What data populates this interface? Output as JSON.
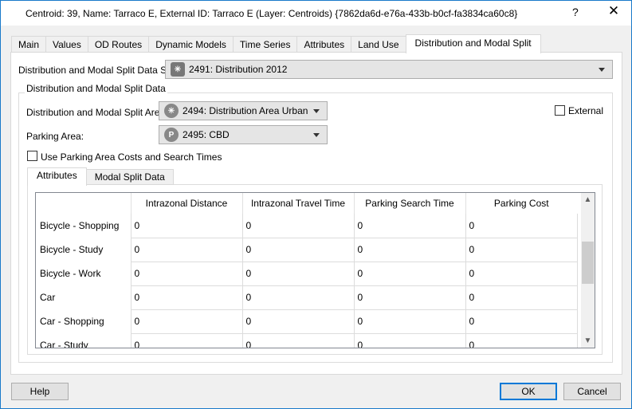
{
  "window": {
    "title": "Centroid: 39, Name: Tarraco E, External ID: Tarraco E (Layer: Centroids) {7862da6d-e76a-433b-b0cf-fa3834ca60c8}",
    "help_glyph": "?",
    "close_glyph": "✕"
  },
  "tabs": [
    {
      "label": "Main",
      "active": false
    },
    {
      "label": "Values",
      "active": false
    },
    {
      "label": "OD Routes",
      "active": false
    },
    {
      "label": "Dynamic Models",
      "active": false
    },
    {
      "label": "Time Series",
      "active": false
    },
    {
      "label": "Attributes",
      "active": false
    },
    {
      "label": "Land Use",
      "active": false
    },
    {
      "label": "Distribution and Modal Split",
      "active": true
    }
  ],
  "form": {
    "dataset_label": "Distribution and Modal Split Data Set:",
    "dataset_value": "2491: Distribution 2012",
    "dataset_icon": "distribution-icon",
    "group_title": "Distribution and Modal Split Data",
    "area_label": "Distribution and Modal Split Area:",
    "area_value": "2494: Distribution Area Urban",
    "area_icon": "distribution-area-icon",
    "parking_label": "Parking Area:",
    "parking_value": "2495: CBD",
    "parking_icon": "parking-icon",
    "parking_icon_glyph": "P",
    "external_label": "External",
    "external_checked": false,
    "use_parking_label": "Use Parking Area Costs and Search Times",
    "use_parking_checked": false
  },
  "subtabs": [
    {
      "label": "Attributes",
      "active": true
    },
    {
      "label": "Modal Split Data",
      "active": false
    }
  ],
  "grid": {
    "columns": [
      "Intrazonal Distance",
      "Intrazonal Travel Time",
      "Parking Search Time",
      "Parking Cost"
    ],
    "rows": [
      {
        "name": "Bicycle - Shopping",
        "values": [
          "0",
          "0",
          "0",
          "0"
        ]
      },
      {
        "name": "Bicycle - Study",
        "values": [
          "0",
          "0",
          "0",
          "0"
        ]
      },
      {
        "name": "Bicycle - Work",
        "values": [
          "0",
          "0",
          "0",
          "0"
        ]
      },
      {
        "name": "Car",
        "values": [
          "0",
          "0",
          "0",
          "0"
        ]
      },
      {
        "name": "Car - Shopping",
        "values": [
          "0",
          "0",
          "0",
          "0"
        ]
      },
      {
        "name": "Car - Study",
        "values": [
          "0",
          "0",
          "0",
          "0"
        ]
      }
    ]
  },
  "buttons": {
    "help": "Help",
    "ok": "OK",
    "cancel": "Cancel"
  }
}
